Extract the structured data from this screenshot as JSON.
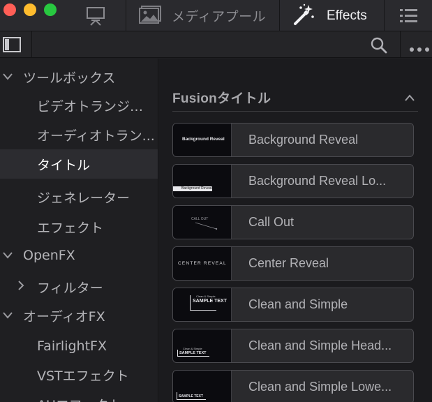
{
  "toolbar": {
    "media_pool_label": "メディアプール",
    "effects_label": "Effects"
  },
  "sidebar": {
    "items": [
      {
        "label": "ツールボックス",
        "expanded": true
      },
      {
        "label": "ビデオトランジシ..."
      },
      {
        "label": "オーディオトラン..."
      },
      {
        "label": "タイトル",
        "selected": true
      },
      {
        "label": "ジェネレーター"
      },
      {
        "label": "エフェクト"
      },
      {
        "label": "OpenFX",
        "expanded": true
      },
      {
        "label": "フィルター",
        "expanded": false
      },
      {
        "label": "オーディオFX",
        "expanded": true
      },
      {
        "label": "FairlightFX"
      },
      {
        "label": "VSTエフェクト"
      },
      {
        "label": "AUエフェクト"
      }
    ]
  },
  "content": {
    "section_title": "Fusionタイトル",
    "items": [
      {
        "label": "Background Reveal",
        "thumb_text": "Background Reveal"
      },
      {
        "label": "Background Reveal Lo...",
        "thumb_text": "Background Reveal"
      },
      {
        "label": "Call Out",
        "thumb_text": "CALL OUT"
      },
      {
        "label": "Center Reveal",
        "thumb_text": "CENTER REVEAL"
      },
      {
        "label": "Clean and Simple",
        "thumb_text": "SAMPLE TEXT",
        "thumb_sub": "Clean & Simple"
      },
      {
        "label": "Clean and Simple Head...",
        "thumb_text": "SAMPLE TEXT",
        "thumb_sub": "Clean & Simple"
      },
      {
        "label": "Clean and Simple Lowe...",
        "thumb_text": "SAMPLE TEXT"
      }
    ]
  },
  "colors": {
    "accent_white": "#f2f2f5",
    "panel": "#1f1f22",
    "card": "#2a2a2d",
    "traffic_red": "#ff5f57",
    "traffic_yellow": "#febc2e",
    "traffic_green": "#28c840"
  }
}
